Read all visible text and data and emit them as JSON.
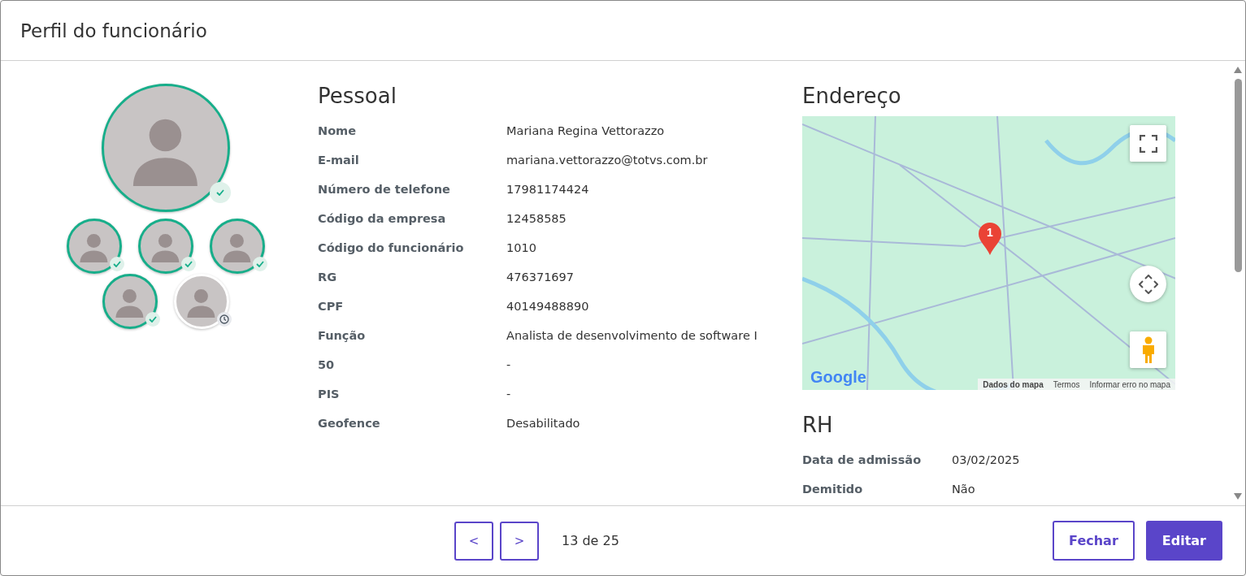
{
  "title": "Perfil do funcionário",
  "photos": [
    {
      "approved": true,
      "main": true
    },
    {
      "approved": true,
      "main": false
    },
    {
      "approved": true,
      "main": false
    },
    {
      "approved": true,
      "main": false
    },
    {
      "approved": true,
      "main": false
    },
    {
      "approved": false,
      "main": false
    }
  ],
  "personal": {
    "heading": "Pessoal",
    "fields": [
      {
        "label": "Nome",
        "value": "Mariana Regina Vettorazzo"
      },
      {
        "label": "E-mail",
        "value": "mariana.vettorazzo@totvs.com.br"
      },
      {
        "label": "Número de telefone",
        "value": "17981174424"
      },
      {
        "label": "Código da empresa",
        "value": "12458585"
      },
      {
        "label": "Código do funcionário",
        "value": "1010"
      },
      {
        "label": "RG",
        "value": "476371697"
      },
      {
        "label": "CPF",
        "value": "40149488890"
      },
      {
        "label": "Função",
        "value": "Analista de desenvolvimento de software I"
      },
      {
        "label": "50",
        "value": "-"
      },
      {
        "label": "PIS",
        "value": "-"
      },
      {
        "label": "Geofence",
        "value": "Desabilitado"
      }
    ]
  },
  "address": {
    "heading": "Endereço",
    "map": {
      "marker": "1",
      "logo": "Google",
      "attribution": [
        "Dados do mapa",
        "Termos",
        "Informar erro no mapa"
      ]
    }
  },
  "hr": {
    "heading": "RH",
    "fields": [
      {
        "label": "Data de admissão",
        "value": "03/02/2025"
      },
      {
        "label": "Demitido",
        "value": "Não"
      }
    ]
  },
  "pager": {
    "prev": "<",
    "next": ">",
    "status": "13 de 25"
  },
  "buttons": [
    {
      "label": "Fechar",
      "kind": "outline"
    },
    {
      "label": "Editar",
      "kind": "primary"
    }
  ]
}
